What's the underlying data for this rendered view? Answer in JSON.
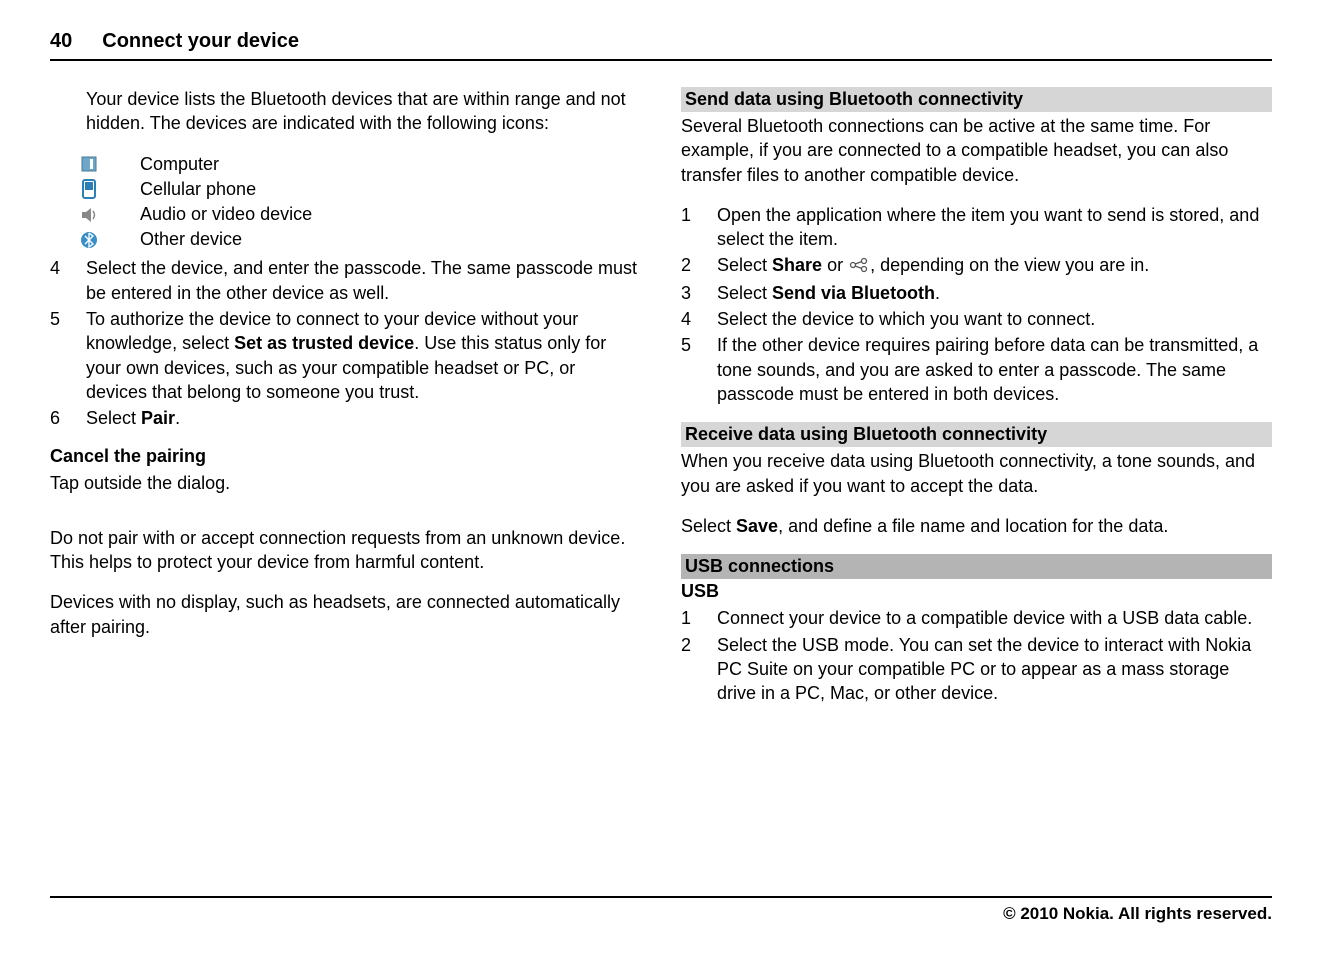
{
  "header": {
    "page_num": "40",
    "title": "Connect your device"
  },
  "left": {
    "intro": "Your device lists the Bluetooth devices that are within range and not hidden. The devices are indicated with the following icons:",
    "icons": {
      "computer": "Computer",
      "phone": "Cellular phone",
      "audio": "Audio or video device",
      "other": "Other device"
    },
    "steps": {
      "s4_num": "4",
      "s4": "Select the device, and enter the passcode. The same passcode must be entered in the other device as well.",
      "s5_num": "5",
      "s5_a": "To authorize the device to connect to your device without your knowledge, select ",
      "s5_bold": "Set as trusted device",
      "s5_b": ". Use this status only for your own devices, such as your compatible headset or PC, or devices that belong to someone you trust.",
      "s6_num": "6",
      "s6_a": "Select ",
      "s6_bold": "Pair",
      "s6_b": "."
    },
    "cancel_h": "Cancel the pairing",
    "cancel_p": "Tap outside the dialog.",
    "warn1": "Do not pair with or accept connection requests from an unknown device. This helps to protect your device from harmful content.",
    "warn2": "Devices with no display, such as headsets, are connected automatically after pairing."
  },
  "right": {
    "send_h": "Send data using Bluetooth connectivity",
    "send_p": "Several Bluetooth connections can be active at the same time. For example, if you are connected to a compatible headset, you can also transfer files to another compatible device.",
    "send_steps": {
      "s1_num": "1",
      "s1": "Open the application where the item you want to send is stored, and select the item.",
      "s2_num": "2",
      "s2_a": "Select ",
      "s2_share": "Share",
      "s2_b": " or ",
      "s2_c": ", depending on the view you are in.",
      "s3_num": "3",
      "s3_a": "Select ",
      "s3_bold": "Send via Bluetooth",
      "s3_b": ".",
      "s4_num": "4",
      "s4": "Select the device to which you want to connect.",
      "s5_num": "5",
      "s5": "If the other device requires pairing before data can be transmitted, a tone sounds, and you are asked to enter a passcode. The same passcode must be entered in both devices."
    },
    "recv_h": "Receive data using Bluetooth connectivity",
    "recv_p1": "When you receive data using Bluetooth connectivity, a tone sounds, and you are asked if you want to accept the data.",
    "recv_p2_a": "Select ",
    "recv_p2_bold": "Save",
    "recv_p2_b": ", and define a file name and location for the data.",
    "usb_h1": "USB connections",
    "usb_h2": "USB",
    "usb_steps": {
      "s1_num": "1",
      "s1": "Connect your device to a compatible device with a USB data cable.",
      "s2_num": "2",
      "s2": "Select the USB mode. You can set the device to interact with Nokia PC Suite on your compatible PC or to appear as a mass storage drive in a PC, Mac, or other device."
    }
  },
  "footer": "© 2010 Nokia. All rights reserved."
}
